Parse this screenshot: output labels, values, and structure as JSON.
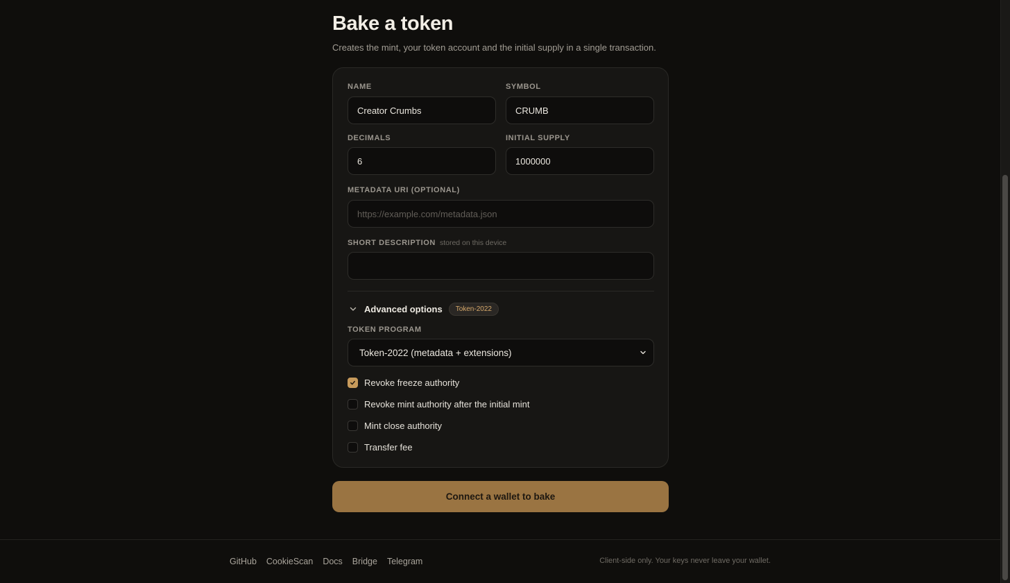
{
  "header": {
    "title": "Bake a token",
    "subtitle": "Creates the mint, your token account and the initial supply in a single transaction."
  },
  "form": {
    "name": {
      "label": "Name",
      "value": "Creator Crumbs",
      "placeholder": ""
    },
    "symbol": {
      "label": "Symbol",
      "value": "CRUMB",
      "placeholder": ""
    },
    "decimals": {
      "label": "Decimals",
      "value": "6",
      "placeholder": ""
    },
    "initial_supply": {
      "label": "Initial supply",
      "value": "1000000",
      "placeholder": ""
    },
    "metadata_uri": {
      "label": "Metadata URI (optional)",
      "value": "",
      "placeholder": "https://example.com/metadata.json"
    },
    "short_description": {
      "label": "Short description",
      "hint": "stored on this device",
      "value": "",
      "placeholder": ""
    }
  },
  "advanced": {
    "label": "Advanced options",
    "badge": "Token-2022",
    "expanded": true,
    "token_program": {
      "label": "Token program",
      "selected": "Token-2022 (metadata + extensions)"
    },
    "options": [
      {
        "label": "Revoke freeze authority",
        "checked": true
      },
      {
        "label": "Revoke mint authority after the initial mint",
        "checked": false
      },
      {
        "label": "Mint close authority",
        "checked": false
      },
      {
        "label": "Transfer fee",
        "checked": false
      }
    ]
  },
  "cta": {
    "label": "Connect a wallet to bake"
  },
  "footer": {
    "links": [
      "GitHub",
      "CookieScan",
      "Docs",
      "Bridge",
      "Telegram"
    ],
    "note": "Client-side only. Your keys never leave your wallet."
  },
  "colors": {
    "background": "#0f0e0c",
    "card": "#171614",
    "accent": "#c79a5b",
    "cta": "#9a7442",
    "badge_text": "#d6a86a"
  },
  "icons": {
    "advanced_toggle": "chevron-down-icon",
    "select": "chevron-down-icon",
    "checked": "check-icon"
  }
}
